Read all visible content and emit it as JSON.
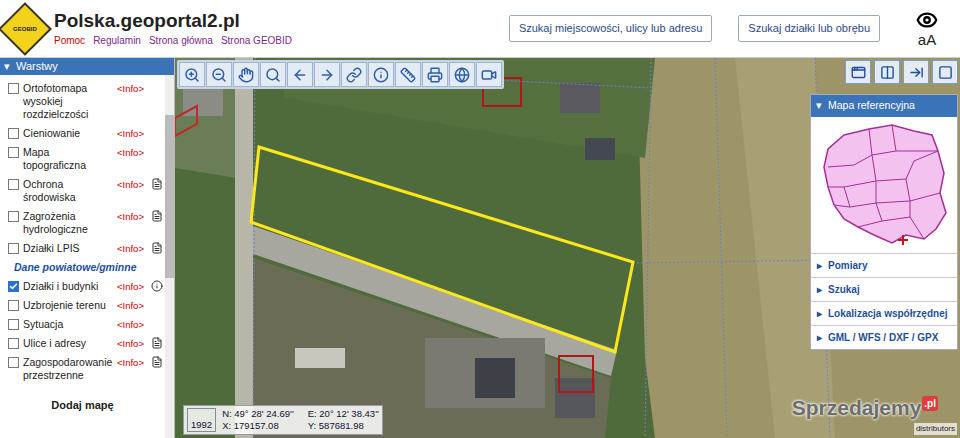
{
  "header": {
    "logo": "GEOBID",
    "title": "Polska.geoportal2.pl",
    "links": [
      {
        "label": "Pomoc",
        "color": "#cc0000"
      },
      {
        "label": "Regulamin",
        "color": "#7a2a8a"
      },
      {
        "label": "Strona główna",
        "color": "#7a2a8a"
      },
      {
        "label": "Strona GEOBID",
        "color": "#7a2a8a"
      }
    ],
    "search_buttons": [
      "Szukaj miejscowości, ulicy lub adresu",
      "Szukaj działki lub obrębu"
    ],
    "font_toggle": "aA"
  },
  "sidebar": {
    "toggle": "▾",
    "title": "Warstwy",
    "items": [
      {
        "kind": "layer",
        "label": "Ortofotomapa wysokiej rozdzielczości",
        "checked": false,
        "info": "<Info>",
        "doc": "none"
      },
      {
        "kind": "layer",
        "label": "Cieniowanie",
        "checked": false,
        "info": "<Info>",
        "doc": "none"
      },
      {
        "kind": "layer",
        "label": "Mapa topograficzna",
        "checked": false,
        "info": "<Info>",
        "doc": "none"
      },
      {
        "kind": "layer",
        "label": "Ochrona środowiska",
        "checked": false,
        "info": "<Info>",
        "doc": "plain"
      },
      {
        "kind": "layer",
        "label": "Zagrożenia hydrologiczne",
        "checked": false,
        "info": "<Info>",
        "doc": "plain"
      },
      {
        "kind": "layer",
        "label": "Działki LPIS",
        "checked": false,
        "info": "<Info>",
        "doc": "plain"
      },
      {
        "kind": "section",
        "label": "Dane powiatowe/gminne"
      },
      {
        "kind": "layer",
        "label": "Działki i budynki",
        "checked": true,
        "info": "<Info>",
        "doc": "info"
      },
      {
        "kind": "layer",
        "label": "Uzbrojenie terenu",
        "checked": false,
        "info": "<Info>",
        "doc": "none"
      },
      {
        "kind": "layer",
        "label": "Sytuacja",
        "checked": false,
        "info": "<Info>",
        "doc": "none"
      },
      {
        "kind": "layer",
        "label": "Ulice i adresy",
        "checked": false,
        "info": "<Info>",
        "doc": "plain"
      },
      {
        "kind": "layer",
        "label": "Zagospodarowanie przestrzenne",
        "checked": false,
        "info": "<Info>",
        "doc": "plain"
      }
    ],
    "add_map": "Dodaj mapę",
    "scroll_level": 0.45
  },
  "map": {
    "coordinates": {
      "system": "1992",
      "n": "N: 49° 28' 24.69''",
      "e": "E: 20° 12' 38.43''",
      "x": "X: 179157.08",
      "y": "Y: 587681.98"
    },
    "watermark": {
      "name": "Sprzedajemy",
      "suffix": ".pl"
    },
    "attribution": "distributors"
  },
  "right_panel": {
    "reference_map": {
      "marker": "▾",
      "title": "Mapa referencyjna"
    },
    "menu": [
      {
        "marker": "▸",
        "label": "Pomiary"
      },
      {
        "marker": "▸",
        "label": "Szukaj"
      },
      {
        "marker": "▸",
        "label": "Lokalizacja współrzędnej"
      },
      {
        "marker": "▸",
        "label": "GML / WFS / DXF / GPX"
      }
    ]
  }
}
